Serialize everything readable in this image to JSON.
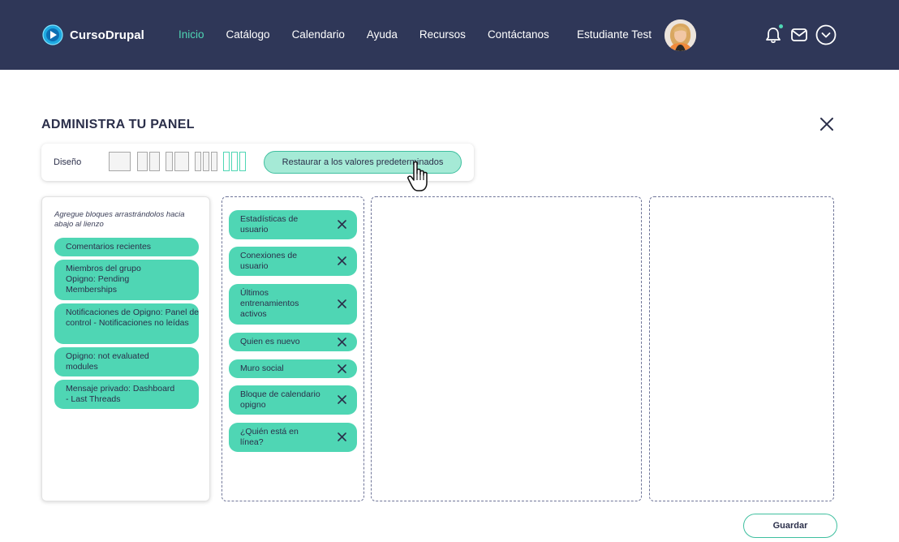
{
  "brand": {
    "name": "CursoDrupal"
  },
  "nav": {
    "items": [
      {
        "label": "Inicio",
        "active": true
      },
      {
        "label": "Catálogo"
      },
      {
        "label": "Calendario"
      },
      {
        "label": "Ayuda"
      },
      {
        "label": "Recursos"
      },
      {
        "label": "Contáctanos"
      }
    ]
  },
  "user": {
    "name": "Estudiante Test"
  },
  "colors": {
    "navbar": "#2f3758",
    "accent": "#4fd6b4",
    "chip": "#4fd6b4",
    "restore": "#a5ead6"
  },
  "panel": {
    "title": "ADMINISTRA TU PANEL",
    "layout_label": "Diseño",
    "restore_label": "Restaurar a los valores predeterminados",
    "save_label": "Guardar"
  },
  "source": {
    "hint": "Agregue bloques arrastrándolos hacia abajo al lienzo",
    "blocks": [
      "Comentarios recientes",
      "Miembros del grupo Opigno: Pending Memberships",
      "Notificaciones de Opigno: Panel de control - Notificaciones no leídas",
      "Opigno: not evaluated modules",
      "Mensaje privado: Dashboard - Last Threads"
    ]
  },
  "column1": {
    "blocks": [
      "Estadísticas de usuario",
      "Conexiones de usuario",
      "Últimos entrenamientos activos",
      "Quien es nuevo",
      "Muro social",
      "Bloque de calendario opigno",
      "¿Quién está en línea?"
    ]
  }
}
